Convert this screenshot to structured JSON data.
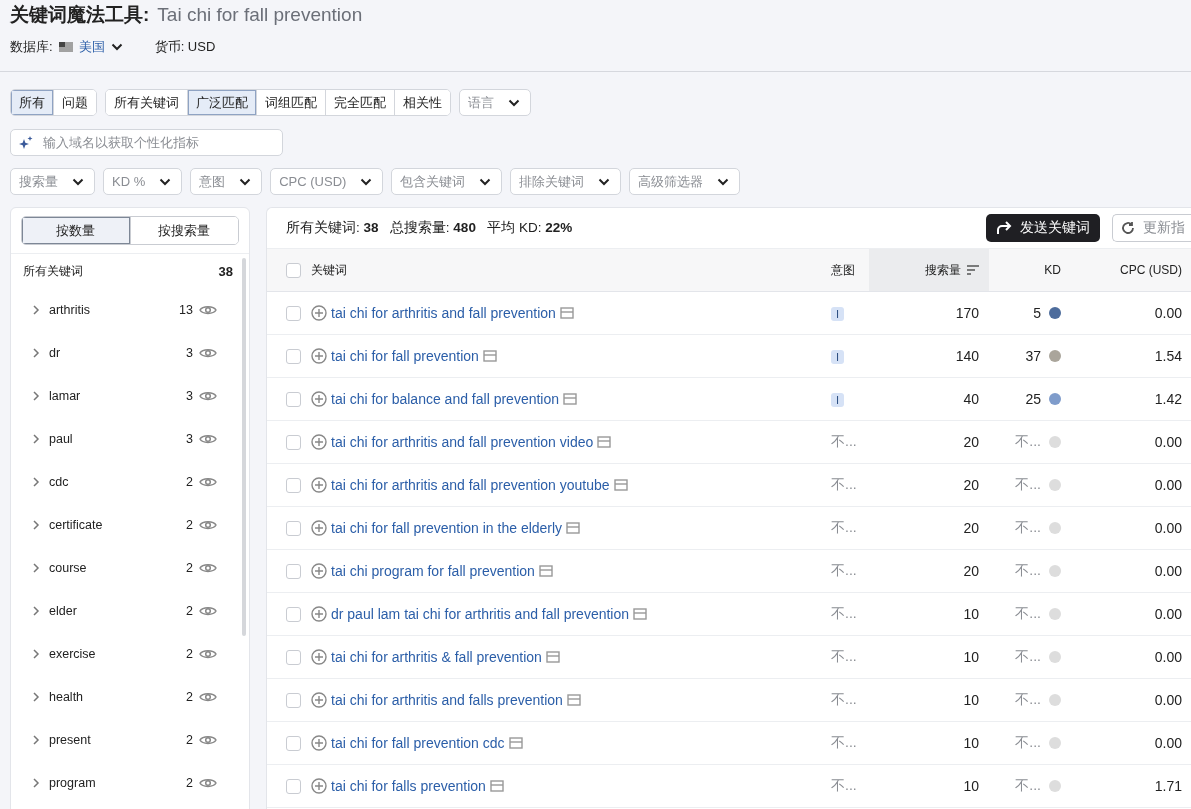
{
  "header": {
    "tool_name": "关键词魔法工具:",
    "query": "Tai chi for fall prevention",
    "database_label": "数据库:",
    "database_value": "美国",
    "currency": "货币: USD"
  },
  "segments": [
    [
      {
        "label": "所有",
        "selected": true
      },
      {
        "label": "问题",
        "selected": false
      }
    ],
    [
      {
        "label": "所有关键词",
        "selected": false
      },
      {
        "label": "广泛匹配",
        "selected": true
      },
      {
        "label": "词组匹配",
        "selected": false
      },
      {
        "label": "完全匹配",
        "selected": false
      },
      {
        "label": "相关性",
        "selected": false
      }
    ]
  ],
  "language_dropdown": "语言",
  "domain_field": {
    "placeholder": "输入域名以获取个性化指标"
  },
  "filters": [
    "搜索量",
    "KD %",
    "意图",
    "CPC (USD)",
    "包含关键词",
    "排除关键词",
    "高级筛选器"
  ],
  "sidebar": {
    "toggle": [
      {
        "label": "按数量",
        "selected": true
      },
      {
        "label": "按搜索量",
        "selected": false
      }
    ],
    "all_label": "所有关键词",
    "all_count": "38",
    "groups": [
      {
        "name": "arthritis",
        "count": "13",
        "expanded": false
      },
      {
        "name": "dr",
        "count": "3",
        "expanded": false
      },
      {
        "name": "lamar",
        "count": "3",
        "expanded": false
      },
      {
        "name": "paul",
        "count": "3",
        "expanded": false
      },
      {
        "name": "cdc",
        "count": "2",
        "expanded": false
      },
      {
        "name": "certificate",
        "count": "2",
        "expanded": false
      },
      {
        "name": "course",
        "count": "2",
        "expanded": false
      },
      {
        "name": "elder",
        "count": "2",
        "expanded": false
      },
      {
        "name": "exercise",
        "count": "2",
        "expanded": false
      },
      {
        "name": "health",
        "count": "2",
        "expanded": false
      },
      {
        "name": "present",
        "count": "2",
        "expanded": false
      },
      {
        "name": "program",
        "count": "2",
        "expanded": false
      }
    ]
  },
  "summary": {
    "all_label": "所有关键词:",
    "all_value": "38",
    "volume_label": "总搜索量:",
    "volume_value": "480",
    "kd_label": "平均 KD:",
    "kd_value": "22%"
  },
  "actions": {
    "send": "发送关键词",
    "update": "更新指"
  },
  "table": {
    "header_checked": false,
    "columns": [
      {
        "label": "关键词",
        "sorted": false
      },
      {
        "label": "意图",
        "sorted": false
      },
      {
        "label": "搜索量",
        "sorted": true
      },
      {
        "label": "KD",
        "sorted": false
      },
      {
        "label": "CPC (USD)",
        "sorted": false
      }
    ],
    "rows": [
      {
        "checked": false,
        "keyword": "tai chi for arthritis and fall prevention",
        "intent": {
          "kind": "badge",
          "label": "I"
        },
        "volume": "170",
        "kd": "5",
        "color": "#4d6c9c",
        "cpc": "0.00"
      },
      {
        "checked": false,
        "keyword": "tai chi for fall prevention",
        "intent": {
          "kind": "badge",
          "label": "I"
        },
        "volume": "140",
        "kd": "37",
        "color": "#aaa59b",
        "cpc": "1.54"
      },
      {
        "checked": false,
        "keyword": "tai chi for balance and fall prevention",
        "intent": {
          "kind": "badge",
          "label": "I"
        },
        "volume": "40",
        "kd": "25",
        "color": "#7f9ccb",
        "cpc": "1.42"
      },
      {
        "checked": false,
        "keyword": "tai chi for arthritis and fall prevention video",
        "intent": {
          "kind": "text",
          "label": "不..."
        },
        "volume": "20",
        "kd": "不...",
        "color": "#dddddd",
        "cpc": "0.00"
      },
      {
        "checked": false,
        "keyword": "tai chi for arthritis and fall prevention youtube",
        "intent": {
          "kind": "text",
          "label": "不..."
        },
        "volume": "20",
        "kd": "不...",
        "color": "#dddddd",
        "cpc": "0.00"
      },
      {
        "checked": false,
        "keyword": "tai chi for fall prevention in the elderly",
        "intent": {
          "kind": "text",
          "label": "不..."
        },
        "volume": "20",
        "kd": "不...",
        "color": "#dddddd",
        "cpc": "0.00"
      },
      {
        "checked": false,
        "keyword": "tai chi program for fall prevention",
        "intent": {
          "kind": "text",
          "label": "不..."
        },
        "volume": "20",
        "kd": "不...",
        "color": "#dddddd",
        "cpc": "0.00"
      },
      {
        "checked": false,
        "keyword": "dr paul lam tai chi for arthritis and fall prevention",
        "intent": {
          "kind": "text",
          "label": "不..."
        },
        "volume": "10",
        "kd": "不...",
        "color": "#dddddd",
        "cpc": "0.00"
      },
      {
        "checked": false,
        "keyword": "tai chi for arthritis & fall prevention",
        "intent": {
          "kind": "text",
          "label": "不..."
        },
        "volume": "10",
        "kd": "不...",
        "color": "#dddddd",
        "cpc": "0.00"
      },
      {
        "checked": false,
        "keyword": "tai chi for arthritis and falls prevention",
        "intent": {
          "kind": "text",
          "label": "不..."
        },
        "volume": "10",
        "kd": "不...",
        "color": "#dddddd",
        "cpc": "0.00"
      },
      {
        "checked": false,
        "keyword": "tai chi for fall prevention cdc",
        "intent": {
          "kind": "text",
          "label": "不..."
        },
        "volume": "10",
        "kd": "不...",
        "color": "#dddddd",
        "cpc": "0.00"
      },
      {
        "checked": false,
        "keyword": "tai chi for falls prevention",
        "intent": {
          "kind": "text",
          "label": "不..."
        },
        "volume": "10",
        "kd": "不...",
        "color": "#dddddd",
        "cpc": "1.71"
      }
    ]
  }
}
